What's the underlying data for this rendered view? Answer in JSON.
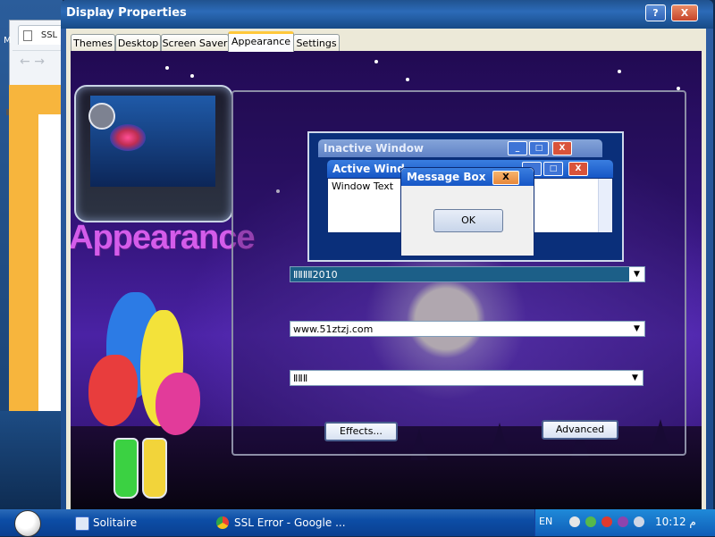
{
  "background_browser": {
    "tab_label": "SSL",
    "left_char": "M",
    "back_arrow": "←",
    "fwd_arrow": "→"
  },
  "dialog": {
    "title": "Display Properties",
    "help_label": "?",
    "close_label": "X",
    "tabs": [
      {
        "label": "Themes",
        "active": false
      },
      {
        "label": "Desktop",
        "active": false
      },
      {
        "label": "Screen Saver",
        "active": false
      },
      {
        "label": "Appearance",
        "active": true
      },
      {
        "label": "Settings",
        "active": false
      }
    ]
  },
  "panel": {
    "art_title": "Appearance",
    "preview": {
      "inactive_title": "Inactive Window",
      "active_title": "Active Wind",
      "window_text": "Window Text",
      "message_box_title": "Message Box",
      "ok_label": "OK",
      "min_glyph": "_",
      "max_glyph": "□",
      "close_glyph": "X"
    },
    "windows_and_buttons": {
      "value": "ⅡⅡⅡⅡ2010",
      "arrow": "▼"
    },
    "color_scheme": {
      "value": "www.51ztzj.com",
      "arrow": "▼"
    },
    "font_size": {
      "value": "ⅡⅡⅡ",
      "arrow": "▼"
    },
    "effects_label": "Effects...",
    "advanced_label": "Advanced"
  },
  "taskbar": {
    "items": [
      {
        "label": "Solitaire"
      },
      {
        "label": "SSL Error - Google ..."
      }
    ],
    "lang": "EN",
    "clock": "10:12 م"
  },
  "colors": {
    "xp_blue": "#0c4da6",
    "tab_accent": "#ffc83c",
    "art_text": "#d45cea"
  }
}
